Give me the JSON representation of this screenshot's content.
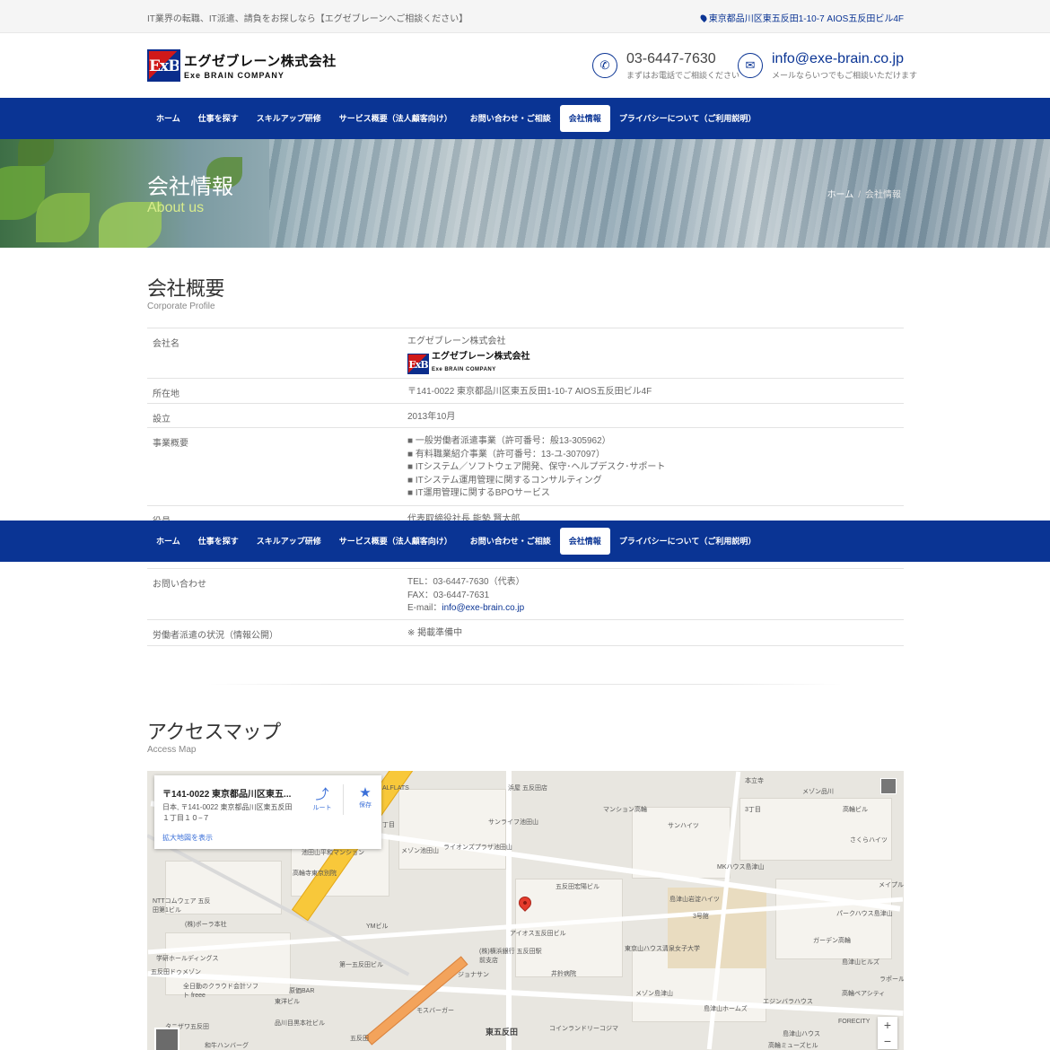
{
  "topbar": {
    "tagline": "IT業界の転職、IT派遣、請負をお探しなら【エグゼブレーンへご相談ください】",
    "address": "東京都品川区東五反田1-10-7 AIOS五反田ビル4F"
  },
  "header": {
    "logo_jp": "エグゼブレーン株式会社",
    "logo_en": "Exe BRAIN COMPANY",
    "logo_mark": "ExB",
    "tel": "03-6447-7630",
    "tel_note": "まずはお電話でご相談ください",
    "email": "info@exe-brain.co.jp",
    "email_note": "メールならいつでもご相談いただけます"
  },
  "nav": {
    "items": [
      "ホーム",
      "仕事を探す",
      "スキルアップ研修",
      "サービス概要（法人顧客向け）",
      "お問い合わせ・ご相談",
      "会社情報",
      "プライバシーについて（ご利用説明）"
    ],
    "active_index": 5
  },
  "hero": {
    "title": "会社情報",
    "subtitle": "About us",
    "breadcrumb_home": "ホーム",
    "breadcrumb_sep": "/",
    "breadcrumb_current": "会社情報"
  },
  "profile": {
    "title": "会社概要",
    "subtitle": "Corporate Profile",
    "rows": [
      {
        "label": "会社名",
        "lines": [
          "エグゼブレーン株式会社"
        ]
      },
      {
        "label": "所在地",
        "lines": [
          "〒141-0022 東京都品川区東五反田1-10-7 AIOS五反田ビル4F"
        ]
      },
      {
        "label": "設立",
        "lines": [
          "2013年10月"
        ]
      },
      {
        "label": "事業概要",
        "lines": [
          "■ 一般労働者派遣事業（許可番号：般13-305962）",
          "■ 有料職業紹介事業（許可番号：13-ユ-307097）",
          "■ ITシステム／ソフトウェア開発、保守･ヘルプデスク･サポート",
          "■ ITシステム運用管理に関するコンサルティング",
          "■ IT運用管理に関するBPOサービス"
        ]
      },
      {
        "label": "役員",
        "lines": [
          "代表取締役社長 能勢 賢太郎"
        ]
      },
      {
        "label": "お問い合わせ",
        "lines": [
          "TEL：03-6447-7630（代表）",
          "FAX：03-6447-7631"
        ],
        "email_prefix": "E-mail：",
        "email": "info@exe-brain.co.jp"
      },
      {
        "label": "労働者派遣の状況（情報公開）",
        "lines": [
          "※ 掲載準備中"
        ]
      }
    ]
  },
  "access": {
    "title": "アクセスマップ",
    "subtitle": "Access Map"
  },
  "map": {
    "card_title": "〒141-0022 東京都品川区東五...",
    "card_address": "日本, 〒141-0022 東京都品川区東五反田１丁目１０−７",
    "card_link": "拡大地図を表示",
    "route_label": "ルート",
    "save_label": "保存",
    "zoom_in": "+",
    "zoom_out": "−",
    "labels": [
      "浜屋 五反田店",
      "本立寺",
      "メゾン品川",
      "高輪ビル",
      "ALFLATS",
      "丁目",
      "3丁目",
      "サンハイツ",
      "マンション高輪",
      "さくらハイツ",
      "サンライフ池田山",
      "ライオンズプラザ池田山",
      "メゾン池田山",
      "池田山平和マンション",
      "高輪寺東京別院",
      "MKハウス島津山",
      "メイプル",
      "NTTコムウェア 五反田第1ビル",
      "五反田宏陽ビル",
      "島津山岩淀ハイツ",
      "パークハウス島津山",
      "(株)ポーラ本社",
      "YMビル",
      "アイオス五反田ビル",
      "3号館",
      "ガーデン高輪",
      "清泉女子大学",
      "学研ホールディングス",
      "第一五反田ビル",
      "(株)横浜銀行 五反田駅前支店",
      "東京山ハウス",
      "島津山ヒルズ",
      "五反田ドゥメゾン",
      "ジョナサン",
      "井鈴病院",
      "ラポール",
      "全日動のクラウド会計ソフト freee",
      "原価BAR",
      "メゾン島津山",
      "高輪ペアシティ",
      "東洋ビル",
      "品川目黒本社ビル",
      "エジンバラハウス",
      "島津山ホームズ",
      "モスバーガー",
      "東五反田",
      "コインランドリーコジマ",
      "FORECITY",
      "タニザワ五反田",
      "五反田",
      "高輪ミューズヒル",
      "島津山ハウス",
      "和牛ハンバーグ"
    ]
  }
}
